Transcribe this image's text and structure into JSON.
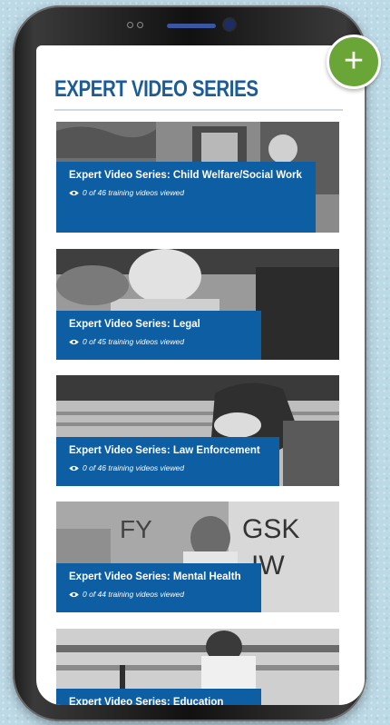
{
  "page": {
    "title": "EXPERT VIDEO SERIES"
  },
  "fab": {
    "label": "+",
    "icon": "plus-icon",
    "color": "#6aa537"
  },
  "cards": [
    {
      "title": "Expert Video Series: Child Welfare/Social Work",
      "progress": "0 of 46 training videos viewed"
    },
    {
      "title": "Expert Video Series: Legal",
      "progress": "0 of 45 training videos viewed"
    },
    {
      "title": "Expert Video Series: Law Enforcement",
      "progress": "0 of 46 training videos viewed"
    },
    {
      "title": "Expert Video Series: Mental Health",
      "progress": "0 of 44 training videos viewed"
    },
    {
      "title": "Expert Video Series: Education",
      "progress": ""
    }
  ],
  "colors": {
    "accent": "#1b5c96",
    "overlay": "#0d5ea3",
    "background": "#bcd9e6"
  }
}
